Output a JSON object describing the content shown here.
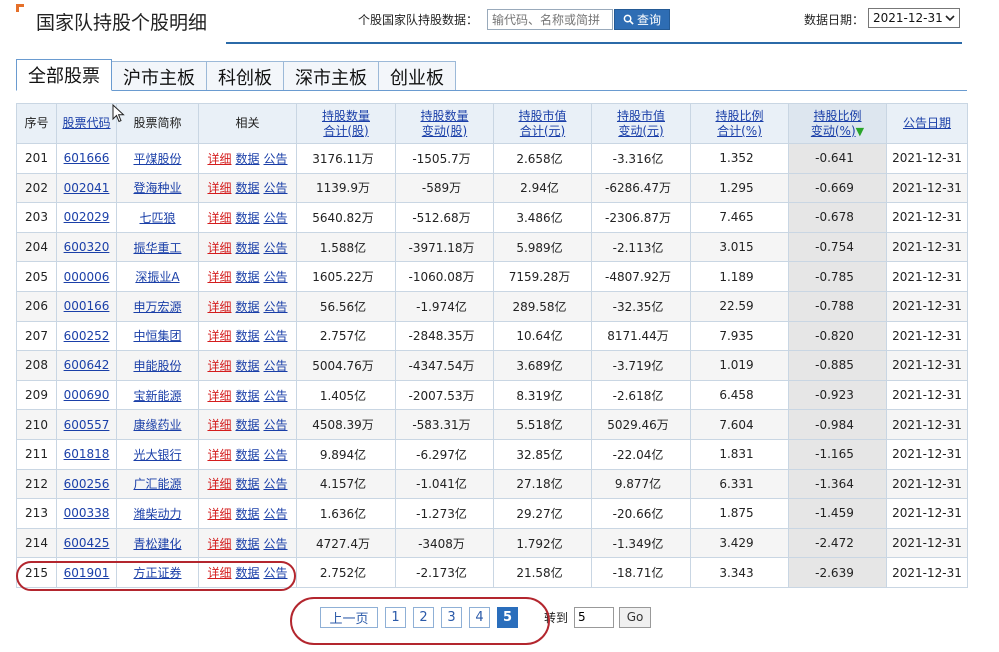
{
  "header": {
    "title": "国家队持股个股明细",
    "search_label": "个股国家队持股数据：",
    "search_placeholder": "输代码、名称或简拼",
    "search_button": "查询",
    "date_label": "数据日期：",
    "date_value": "2021-12-31"
  },
  "tabs": [
    {
      "label": "全部股票",
      "active": true
    },
    {
      "label": "沪市主板",
      "active": false
    },
    {
      "label": "科创板",
      "active": false
    },
    {
      "label": "深市主板",
      "active": false
    },
    {
      "label": "创业板",
      "active": false
    }
  ],
  "table": {
    "headers": {
      "seq": "序号",
      "code": "股票代码",
      "name": "股票简称",
      "related": "相关",
      "hold_qty_1": "持股数量",
      "hold_qty_2": "合计(股)",
      "qty_chg_1": "持股数量",
      "qty_chg_2": "变动(股)",
      "hold_val_1": "持股市值",
      "hold_val_2": "合计(元)",
      "val_chg_1": "持股市值",
      "val_chg_2": "变动(元)",
      "ratio_1": "持股比例",
      "ratio_2": "合计(%)",
      "ratio_chg_1": "持股比例",
      "ratio_chg_2": "变动(%)",
      "date": "公告日期"
    },
    "links": {
      "detail": "详细",
      "data": "数据",
      "notice": "公告"
    },
    "rows": [
      {
        "seq": "201",
        "code": "601666",
        "name": "平煤股份",
        "qty": "3176.11万",
        "qty_chg": "-1505.7万",
        "val": "2.658亿",
        "val_chg": "-3.316亿",
        "ratio": "1.352",
        "ratio_chg": "-0.641",
        "date": "2021-12-31"
      },
      {
        "seq": "202",
        "code": "002041",
        "name": "登海种业",
        "qty": "1139.9万",
        "qty_chg": "-589万",
        "val": "2.94亿",
        "val_chg": "-6286.47万",
        "ratio": "1.295",
        "ratio_chg": "-0.669",
        "date": "2021-12-31"
      },
      {
        "seq": "203",
        "code": "002029",
        "name": "七匹狼",
        "qty": "5640.82万",
        "qty_chg": "-512.68万",
        "val": "3.486亿",
        "val_chg": "-2306.87万",
        "ratio": "7.465",
        "ratio_chg": "-0.678",
        "date": "2021-12-31"
      },
      {
        "seq": "204",
        "code": "600320",
        "name": "振华重工",
        "qty": "1.588亿",
        "qty_chg": "-3971.18万",
        "val": "5.989亿",
        "val_chg": "-2.113亿",
        "ratio": "3.015",
        "ratio_chg": "-0.754",
        "date": "2021-12-31"
      },
      {
        "seq": "205",
        "code": "000006",
        "name": "深振业A",
        "qty": "1605.22万",
        "qty_chg": "-1060.08万",
        "val": "7159.28万",
        "val_chg": "-4807.92万",
        "ratio": "1.189",
        "ratio_chg": "-0.785",
        "date": "2021-12-31"
      },
      {
        "seq": "206",
        "code": "000166",
        "name": "申万宏源",
        "qty": "56.56亿",
        "qty_chg": "-1.974亿",
        "val": "289.58亿",
        "val_chg": "-32.35亿",
        "ratio": "22.59",
        "ratio_chg": "-0.788",
        "date": "2021-12-31"
      },
      {
        "seq": "207",
        "code": "600252",
        "name": "中恒集团",
        "qty": "2.757亿",
        "qty_chg": "-2848.35万",
        "val": "10.64亿",
        "val_chg": "8171.44万",
        "ratio": "7.935",
        "ratio_chg": "-0.820",
        "date": "2021-12-31"
      },
      {
        "seq": "208",
        "code": "600642",
        "name": "申能股份",
        "qty": "5004.76万",
        "qty_chg": "-4347.54万",
        "val": "3.689亿",
        "val_chg": "-3.719亿",
        "ratio": "1.019",
        "ratio_chg": "-0.885",
        "date": "2021-12-31"
      },
      {
        "seq": "209",
        "code": "000690",
        "name": "宝新能源",
        "qty": "1.405亿",
        "qty_chg": "-2007.53万",
        "val": "8.319亿",
        "val_chg": "-2.618亿",
        "ratio": "6.458",
        "ratio_chg": "-0.923",
        "date": "2021-12-31"
      },
      {
        "seq": "210",
        "code": "600557",
        "name": "康缘药业",
        "qty": "4508.39万",
        "qty_chg": "-583.31万",
        "val": "5.518亿",
        "val_chg": "5029.46万",
        "ratio": "7.604",
        "ratio_chg": "-0.984",
        "date": "2021-12-31"
      },
      {
        "seq": "211",
        "code": "601818",
        "name": "光大银行",
        "qty": "9.894亿",
        "qty_chg": "-6.297亿",
        "val": "32.85亿",
        "val_chg": "-22.04亿",
        "ratio": "1.831",
        "ratio_chg": "-1.165",
        "date": "2021-12-31"
      },
      {
        "seq": "212",
        "code": "600256",
        "name": "广汇能源",
        "qty": "4.157亿",
        "qty_chg": "-1.041亿",
        "val": "27.18亿",
        "val_chg": "9.877亿",
        "ratio": "6.331",
        "ratio_chg": "-1.364",
        "date": "2021-12-31"
      },
      {
        "seq": "213",
        "code": "000338",
        "name": "潍柴动力",
        "qty": "1.636亿",
        "qty_chg": "-1.273亿",
        "val": "29.27亿",
        "val_chg": "-20.66亿",
        "ratio": "1.875",
        "ratio_chg": "-1.459",
        "date": "2021-12-31"
      },
      {
        "seq": "214",
        "code": "600425",
        "name": "青松建化",
        "qty": "4727.4万",
        "qty_chg": "-3408万",
        "val": "1.792亿",
        "val_chg": "-1.349亿",
        "ratio": "3.429",
        "ratio_chg": "-2.472",
        "date": "2021-12-31"
      },
      {
        "seq": "215",
        "code": "601901",
        "name": "方正证券",
        "qty": "2.752亿",
        "qty_chg": "-2.173亿",
        "val": "21.58亿",
        "val_chg": "-18.71亿",
        "ratio": "3.343",
        "ratio_chg": "-2.639",
        "date": "2021-12-31"
      }
    ]
  },
  "pager": {
    "prev": "上一页",
    "pages": [
      "1",
      "2",
      "3",
      "4",
      "5"
    ],
    "current": "5",
    "goto_label": "转到",
    "goto_value": "5",
    "go_button": "Go"
  },
  "colors": {
    "accent_blue": "#2e6db4",
    "negative_green": "#079e07",
    "positive_red": "#e01a1a",
    "highlight_ring": "#b3262e"
  }
}
